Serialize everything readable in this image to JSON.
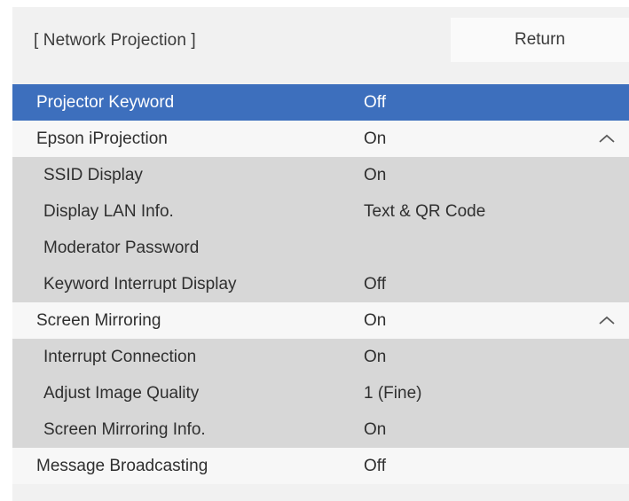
{
  "header": {
    "title": "[ Network Projection ]",
    "return_label": "Return"
  },
  "menu": {
    "items": [
      {
        "label": "Projector Keyword",
        "value": "Off"
      },
      {
        "label": "Epson iProjection",
        "value": "On",
        "icon": "chevron-up-icon"
      },
      {
        "label": "SSID Display",
        "value": "On"
      },
      {
        "label": "Display LAN Info.",
        "value": "Text & QR Code"
      },
      {
        "label": "Moderator Password",
        "value": ""
      },
      {
        "label": "Keyword Interrupt Display",
        "value": "Off"
      },
      {
        "label": "Screen Mirroring",
        "value": "On",
        "icon": "chevron-up-icon"
      },
      {
        "label": "Interrupt Connection",
        "value": "On"
      },
      {
        "label": "Adjust Image Quality",
        "value": "1 (Fine)"
      },
      {
        "label": "Screen Mirroring Info.",
        "value": "On"
      },
      {
        "label": "Message Broadcasting",
        "value": "Off"
      }
    ]
  },
  "colors": {
    "selection": "#3d6fbd",
    "panel": "#f1f1f1",
    "main_row": "#f7f7f7",
    "sub_row": "#d7d7d7"
  }
}
